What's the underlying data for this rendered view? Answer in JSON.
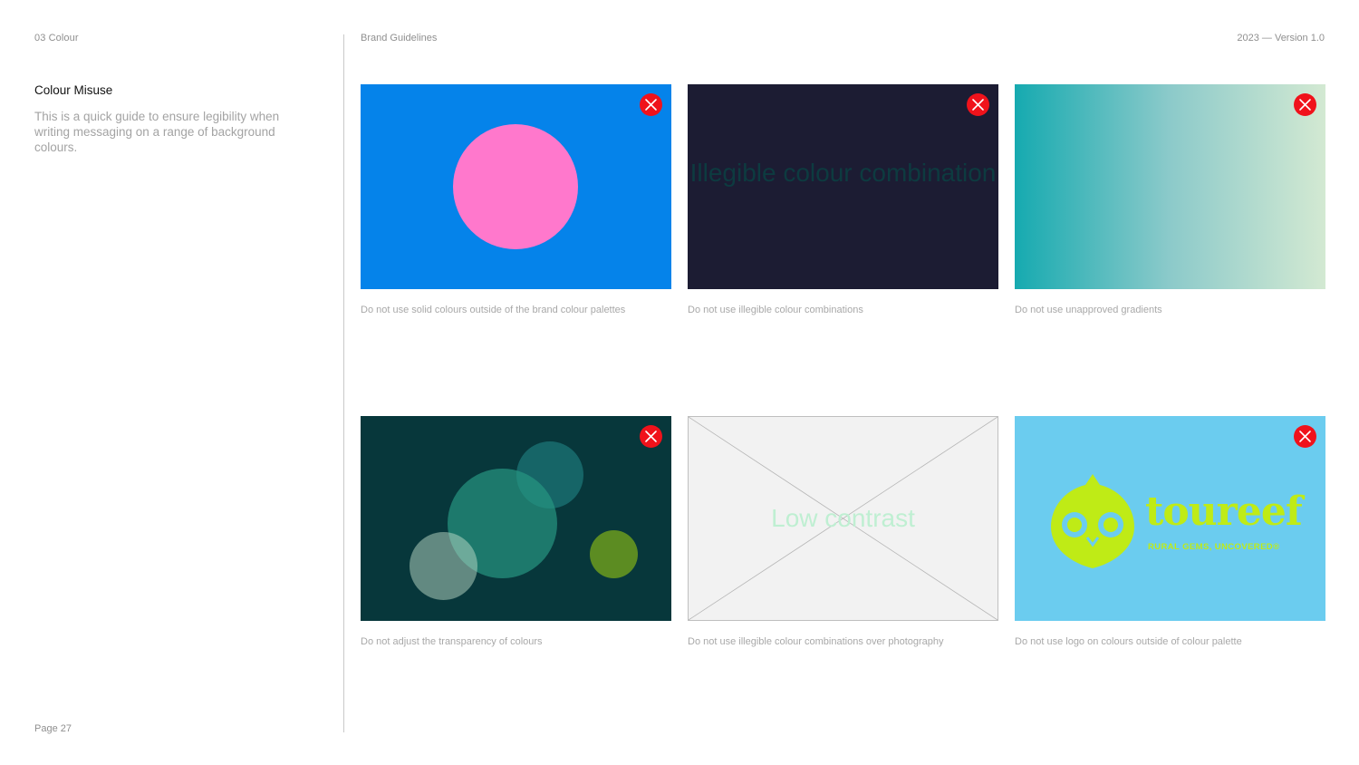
{
  "section_label": "03  Colour",
  "header": {
    "left": "Brand Guidelines",
    "right": "2023 — Version 1.0"
  },
  "title": "Colour Misuse",
  "intro": "This is a quick guide to ensure legibility when writing messaging on a range of background colours.",
  "page_number": "Page 27",
  "colors": {
    "error_badge": "#f0121b",
    "card1_bg": "#0583ea",
    "card1_circle": "#ff78cc",
    "card2_bg": "#1c1c33",
    "card2_text": "#0d3b40",
    "card3_gradient": [
      "#16aab0",
      "#d3e9d2"
    ],
    "card4_bg": "#07373b",
    "card5_bg": "#f2f2f2",
    "card5_text": "#bfefd2",
    "card6_bg": "#6bccef",
    "logo": "#bfeb16"
  },
  "cards": [
    {
      "badge_icon": "close-icon",
      "caption": "Do not use solid colours outside of the brand colour palettes"
    },
    {
      "badge_icon": "close-icon",
      "overlay_text": "Illegible colour combination",
      "caption": "Do not use illegible colour combinations"
    },
    {
      "badge_icon": "close-icon",
      "caption": "Do not use unapproved gradients"
    },
    {
      "badge_icon": "close-icon",
      "caption": "Do not adjust the transparency of colours"
    },
    {
      "placeholder_icon": "image-placeholder-cross",
      "overlay_text": "Low contrast",
      "caption": "Do not use illegible colour combinations over photography"
    },
    {
      "badge_icon": "close-icon",
      "logo_word": "toureef",
      "logo_tagline": "RURAL GEMS, UNCOVERED®",
      "caption": "Do not use logo on colours outside of colour palette"
    }
  ]
}
